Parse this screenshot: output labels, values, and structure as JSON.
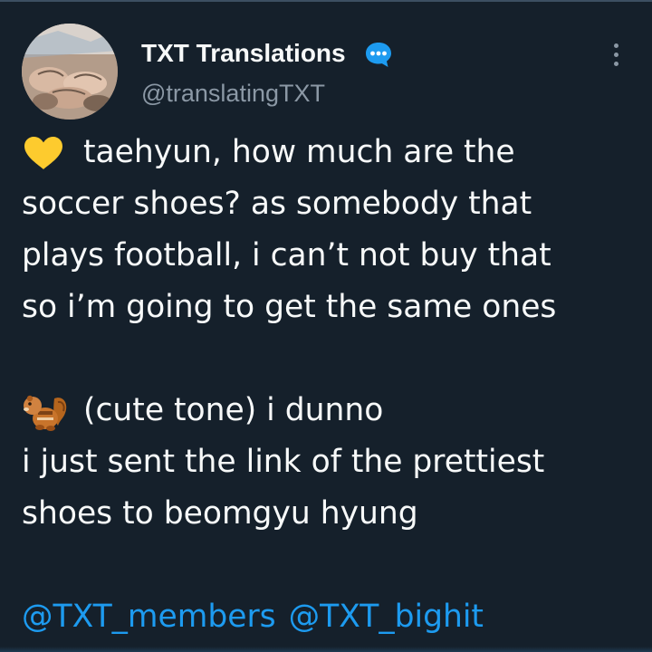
{
  "tweet": {
    "author": {
      "display_name": "TXT Translations",
      "handle": "@translatingTXT",
      "verified_badge_icon": "speech-bubble-icon"
    },
    "more_icon": "more-options-icon",
    "lines": [
      {
        "emoji": "yellow-heart-icon",
        "text": "taehyun, how much are the"
      },
      {
        "text": "soccer shoes? as somebody that"
      },
      {
        "text": "plays football, i can’t not buy that"
      },
      {
        "text": "so i’m going to get the same ones"
      },
      {
        "text": ""
      },
      {
        "emoji": "chipmunk-icon",
        "text": "(cute tone) i dunno"
      },
      {
        "text": "i just sent the link of the prettiest"
      },
      {
        "text": "shoes to beomgyu hyung"
      },
      {
        "text": ""
      }
    ],
    "mentions": [
      "@TXT_members",
      "@TXT_bighit"
    ]
  },
  "colors": {
    "background": "#15202b",
    "text": "#f7f9f9",
    "secondary": "#8b98a5",
    "link": "#1d9bf0"
  }
}
